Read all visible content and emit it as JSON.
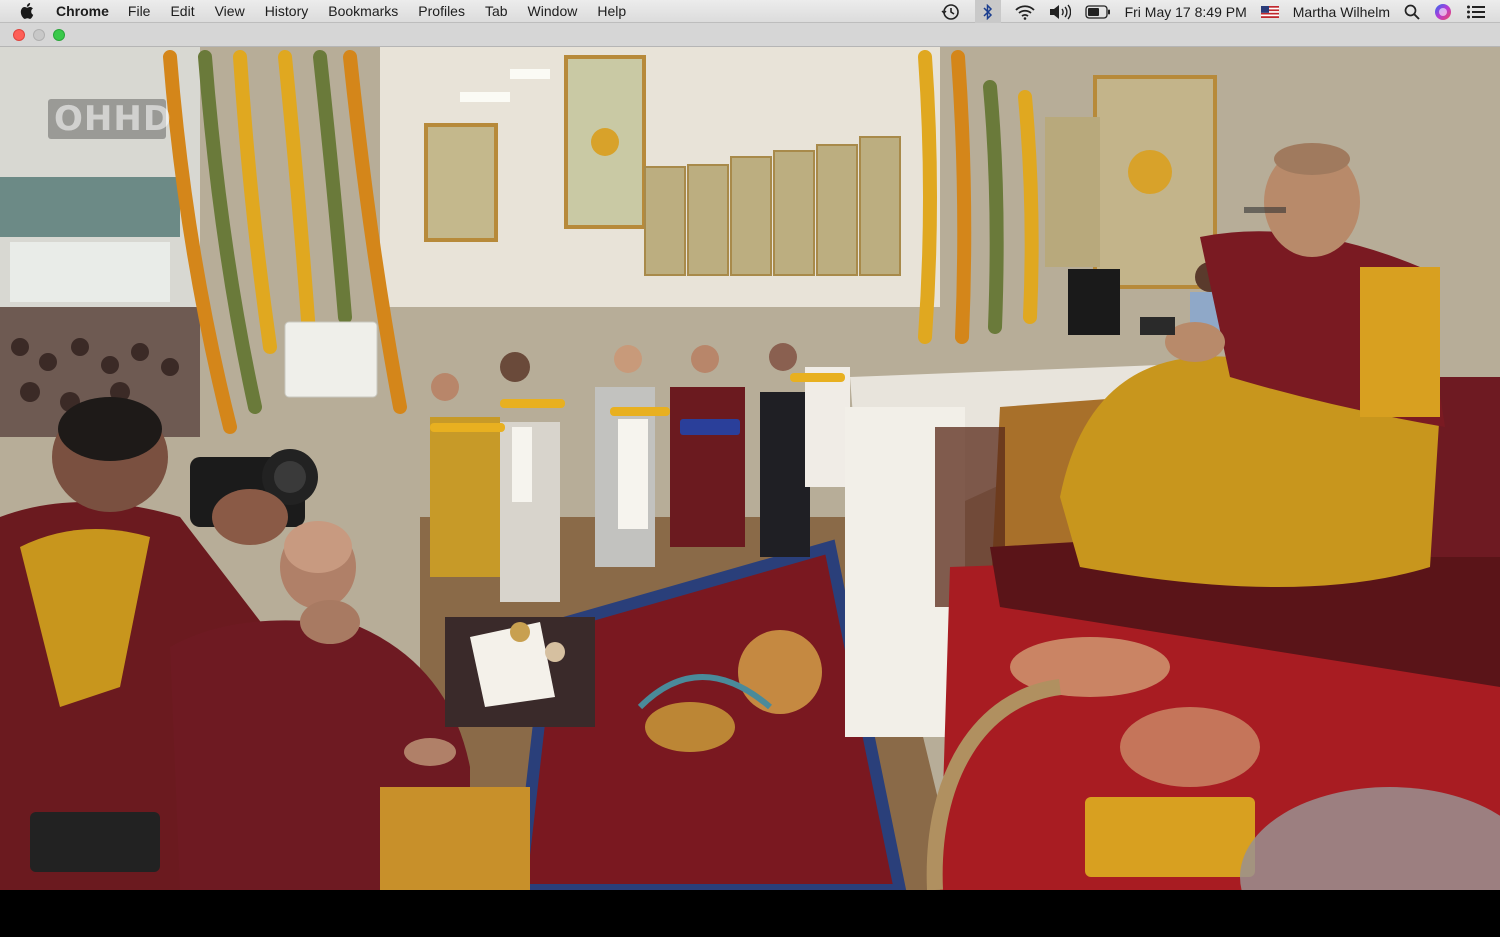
{
  "menubar": {
    "apple_icon": "apple-logo-icon",
    "app_name": "Chrome",
    "menus": [
      "File",
      "Edit",
      "View",
      "History",
      "Bookmarks",
      "Profiles",
      "Tab",
      "Window",
      "Help"
    ],
    "status_icons": [
      "time-machine-icon",
      "bluetooth-icon",
      "wifi-icon",
      "volume-icon",
      "battery-icon"
    ],
    "clock": "Fri May 17  8:49 PM",
    "input_flag_icon": "us-flag-icon",
    "user_name": "Martha Wilhelm",
    "right_icons": [
      "spotlight-search-icon",
      "siri-icon",
      "control-center-list-icon"
    ]
  },
  "window": {
    "controls": [
      "close",
      "minimize",
      "maximize"
    ]
  },
  "video": {
    "watermark": "OHHD",
    "scene": "video-frame",
    "colors": {
      "robe_maroon": "#6b1a1f",
      "robe_saffron": "#c8961d",
      "carpet_red": "#7a1820",
      "wall_cream": "#e7e2d5"
    }
  }
}
